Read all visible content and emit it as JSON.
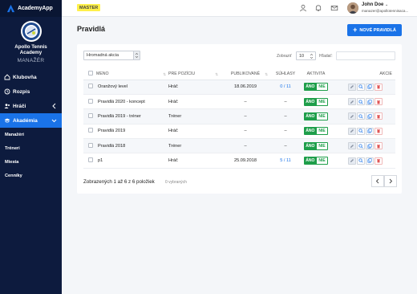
{
  "app": {
    "name": "AcademyApp"
  },
  "club": {
    "name": "Apollo Tennis Academy",
    "role": "MANAŽÉR"
  },
  "nav": [
    {
      "label": "Klubovňa",
      "icon": "home-icon"
    },
    {
      "label": "Rozpis",
      "icon": "clock-icon"
    },
    {
      "label": "Hráči",
      "icon": "users-icon"
    },
    {
      "label": "Akadémia",
      "icon": "graduation-cap-icon",
      "active": true
    }
  ],
  "subnav": [
    "Manažéri",
    "Tréneri",
    "Miesta",
    "Cenníky"
  ],
  "topbar": {
    "badge": "MASTER",
    "user_name": "John Doe",
    "user_email": "manazer@apollotennisaca..."
  },
  "page": {
    "title": "Pravidlá",
    "new_button": "NOVÉ PRAVIDLÁ"
  },
  "toolbar": {
    "bulk_action": "Hromadná akcia",
    "show_label": "Zobraziť",
    "page_size": "10",
    "search_label": "Hľadať:",
    "search_value": ""
  },
  "table": {
    "columns": [
      "MENO",
      "PRE POZÍCIU",
      "PUBLIKOVANÉ",
      "SÚHLASY",
      "AKTIVITA",
      "AKCIE"
    ],
    "rows": [
      {
        "name": "Oranžový level",
        "position": "Hráč",
        "published": "18.06.2019",
        "consents": "0 / 11",
        "on": "ÁNO",
        "off": "NIE"
      },
      {
        "name": "Pravidlá 2020 - koncept",
        "position": "Hráč",
        "published": "–",
        "consents": "–",
        "on": "ÁNO",
        "off": "NIE"
      },
      {
        "name": "Pravidlá 2019 - tréner",
        "position": "Tréner",
        "published": "–",
        "consents": "–",
        "on": "ÁNO",
        "off": "NIE"
      },
      {
        "name": "Pravidlá 2019",
        "position": "Hráč",
        "published": "–",
        "consents": "–",
        "on": "ÁNO",
        "off": "NIE"
      },
      {
        "name": "Pravidlá 2018",
        "position": "Tréner",
        "published": "–",
        "consents": "–",
        "on": "ÁNO",
        "off": "NIE"
      },
      {
        "name": "p1",
        "position": "Hráč",
        "published": "25.09.2018",
        "consents": "5 / 11",
        "on": "ÁNO",
        "off": "NIE"
      }
    ]
  },
  "footer": {
    "summary": "Zobrazených 1 až 6 z 6 položiek",
    "selected": "0 vybraných"
  },
  "colors": {
    "accent": "#1a73e8",
    "sidebar": "#0d1b3e",
    "success": "#1e9e4a",
    "badge": "#fff04a"
  }
}
